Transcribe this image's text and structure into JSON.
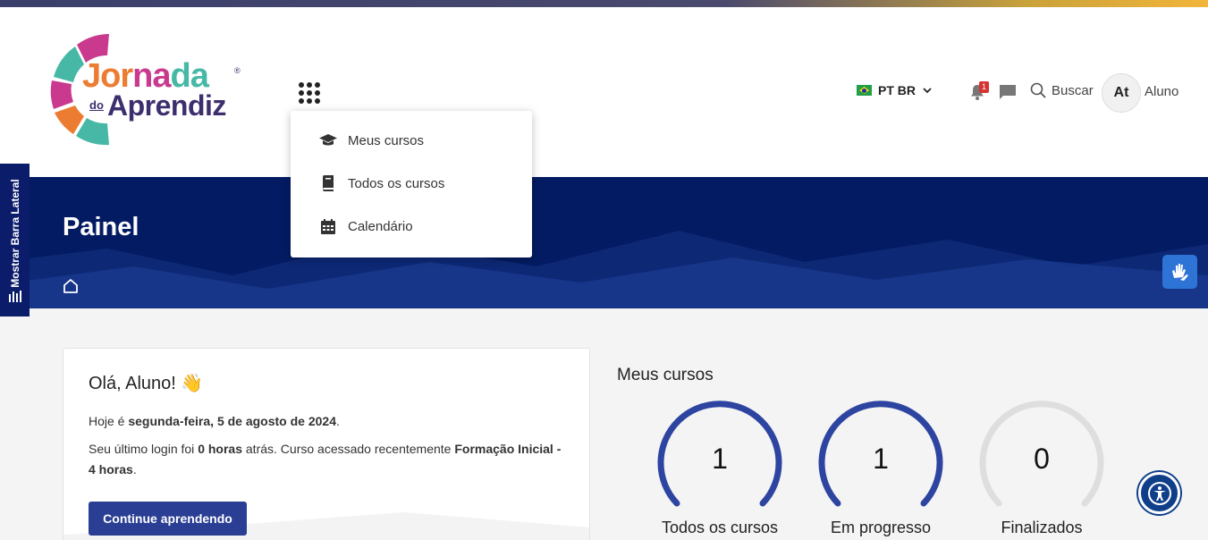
{
  "logo": {
    "word1_a": "Jor",
    "word1_b": "na",
    "word1_c": "da",
    "do": "do",
    "word2": "Aprendiz",
    "reg": "®"
  },
  "header": {
    "apps_icon": "grid-dots-icon",
    "language": "PT BR",
    "notification_count": "1",
    "search_label": "Buscar",
    "avatar_initials": "At",
    "user_name": "Aluno"
  },
  "menu": {
    "items": [
      {
        "label": "Meus cursos",
        "icon": "graduation-cap-icon"
      },
      {
        "label": "Todos os cursos",
        "icon": "book-icon"
      },
      {
        "label": "Calendário",
        "icon": "calendar-icon"
      }
    ]
  },
  "sidebar_toggle": {
    "label": "Mostrar Barra Lateral"
  },
  "hero": {
    "title": "Painel"
  },
  "welcome": {
    "greeting": "Olá, Aluno!",
    "emoji": "👋",
    "today_prefix": "Hoje é ",
    "today_date": "segunda-feira, 5 de agosto de 2024",
    "today_suffix": ".",
    "login_prefix": "Seu último login foi ",
    "login_hours": "0 horas",
    "login_mid": " atrás. Curso acessado recentemente ",
    "recent_course": "Formação Inicial - 4 horas",
    "login_suffix": ".",
    "continue_button": "Continue aprendendo"
  },
  "my_courses": {
    "title": "Meus cursos",
    "stats": [
      {
        "value": "1",
        "label": "Todos os cursos",
        "color": "#2d44a0"
      },
      {
        "value": "1",
        "label": "Em progresso",
        "color": "#2d44a0"
      },
      {
        "value": "0",
        "label": "Finalizados",
        "color": "#dedede"
      }
    ]
  },
  "colors": {
    "navy": "#031b62",
    "button": "#2a3e94",
    "libras": "#2e74d6"
  }
}
